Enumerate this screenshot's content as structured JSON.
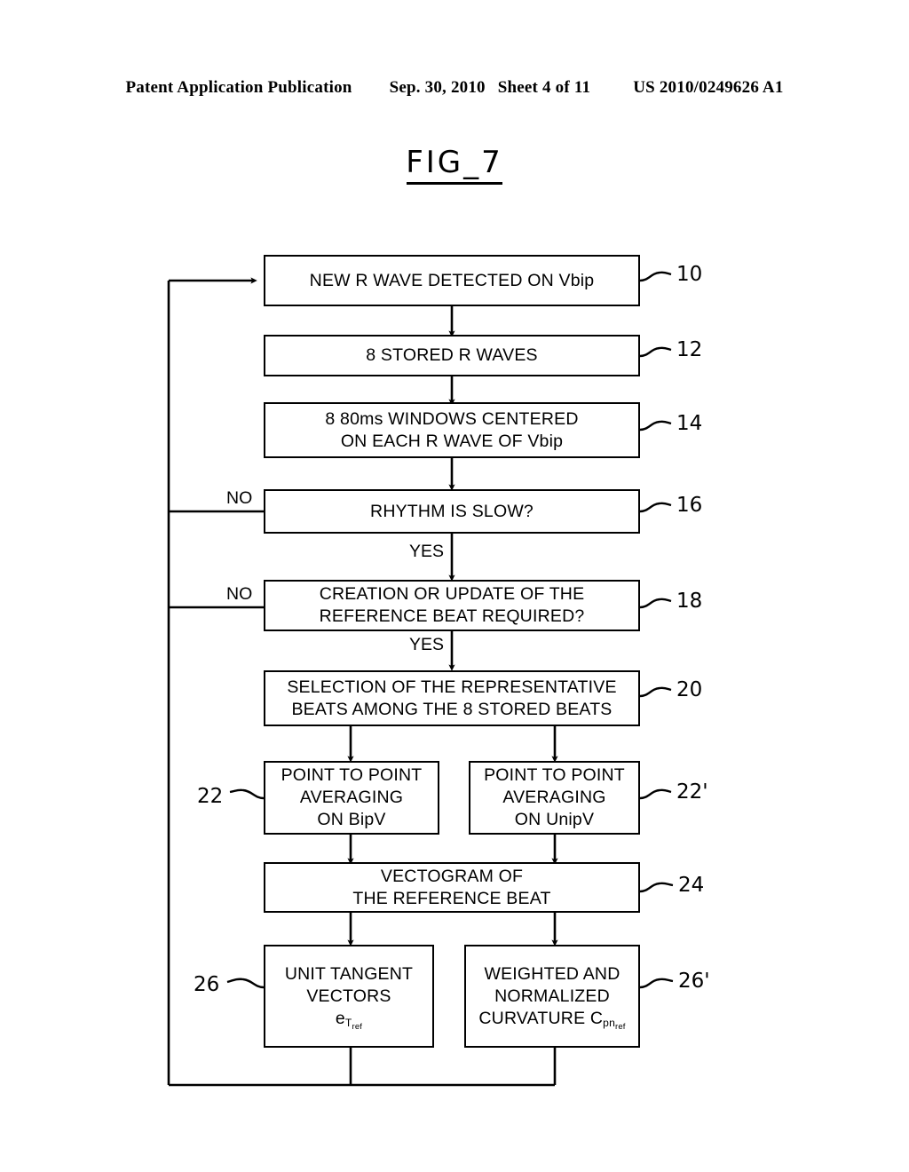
{
  "header": {
    "publication": "Patent Application Publication",
    "date": "Sep. 30, 2010",
    "sheet": "Sheet 4 of 11",
    "docnumber": "US 2010/0249626 A1"
  },
  "figure": {
    "title": "FIG_7"
  },
  "flowchart": {
    "nodes": [
      {
        "id": "n10",
        "ref": "10",
        "lines": [
          "NEW R WAVE DETECTED ON Vbip"
        ]
      },
      {
        "id": "n12",
        "ref": "12",
        "lines": [
          "8 STORED R WAVES"
        ]
      },
      {
        "id": "n14",
        "ref": "14",
        "lines": [
          "8 80ms WINDOWS CENTERED",
          "ON EACH R WAVE OF Vbip"
        ]
      },
      {
        "id": "n16",
        "ref": "16",
        "lines": [
          "RHYTHM IS SLOW?"
        ]
      },
      {
        "id": "n18",
        "ref": "18",
        "lines": [
          "CREATION OR UPDATE OF THE",
          "REFERENCE BEAT REQUIRED?"
        ]
      },
      {
        "id": "n20",
        "ref": "20",
        "lines": [
          "SELECTION OF THE REPRESENTATIVE",
          "BEATS AMONG THE 8 STORED BEATS"
        ]
      },
      {
        "id": "n22",
        "ref": "22",
        "lines": [
          "POINT TO POINT",
          "AVERAGING",
          "ON BipV"
        ]
      },
      {
        "id": "n22p",
        "ref": "22'",
        "lines": [
          "POINT TO POINT",
          "AVERAGING",
          "ON UnipV"
        ]
      },
      {
        "id": "n24",
        "ref": "24",
        "lines": [
          "VECTOGRAM OF",
          "THE REFERENCE BEAT"
        ]
      },
      {
        "id": "n26",
        "ref": "26",
        "lines": [
          "UNIT TANGENT",
          "VECTORS",
          "eT_ref"
        ]
      },
      {
        "id": "n26p",
        "ref": "26'",
        "lines": [
          "WEIGHTED AND",
          "NORMALIZED",
          "CURVATURE Cpn_ref"
        ]
      }
    ],
    "edge_labels": {
      "no_16": "NO",
      "yes_16": "YES",
      "no_18": "NO",
      "yes_18": "YES"
    },
    "colors": {
      "line": "#000000",
      "background": "#ffffff"
    }
  }
}
